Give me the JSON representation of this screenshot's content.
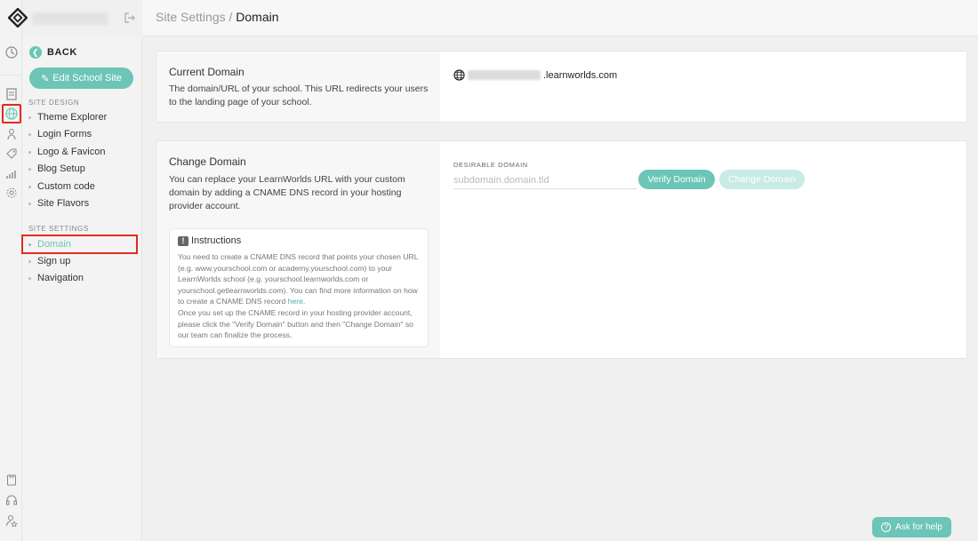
{
  "breadcrumb": {
    "parent": "Site Settings",
    "separator": " / ",
    "current": "Domain"
  },
  "nav": {
    "back_label": "BACK",
    "edit_button": "Edit School Site",
    "site_design_label": "SITE DESIGN",
    "site_design_items": [
      "Theme Explorer",
      "Login Forms",
      "Logo & Favicon",
      "Blog Setup",
      "Custom code",
      "Site Flavors"
    ],
    "site_settings_label": "SITE SETTINGS",
    "site_settings_items": [
      "Domain",
      "Sign up",
      "Navigation"
    ],
    "active_item": "Domain"
  },
  "current_domain": {
    "title": "Current Domain",
    "description": "The domain/URL of your school. This URL redirects your users to the landing page of your school.",
    "domain_suffix": ".learnworlds.com"
  },
  "change_domain": {
    "title": "Change Domain",
    "description": "You can replace your LearnWorlds URL with your custom domain by adding a CNAME DNS record in your hosting provider account.",
    "field_label": "DESIRABLE DOMAIN",
    "field_placeholder": "subdomain.domain.tld",
    "field_value": "",
    "verify_button": "Verify Domain",
    "change_button": "Change Domain",
    "instructions": {
      "title": "Instructions",
      "text_part1": "You need to create a CNAME DNS record that points your chosen URL (e.g. www.yourschool.com or academy.yourschool.com) to your LearnWorlds school (e.g. yourschool.learnworlds.com or yourschool.getlearnworlds.com). You can find more information on how to create a CNAME DNS record ",
      "link": "here",
      "text_part2": ".",
      "text_part3": "Once you set up the CNAME record in your hosting provider account, please click the \"Verify Domain\" button and then \"Change Domain\" so our team can finalize the process."
    }
  },
  "help_button": "Ask for help",
  "colors": {
    "accent": "#6cc5b6",
    "accent_disabled": "#c8ebe5",
    "highlight": "#e02b20"
  },
  "rail_icons": [
    "dashboard-icon",
    "pages-icon",
    "globe-icon",
    "users-icon",
    "tag-icon",
    "analytics-icon",
    "settings-icon",
    "clipboard-icon",
    "headset-icon",
    "user-star-icon"
  ]
}
